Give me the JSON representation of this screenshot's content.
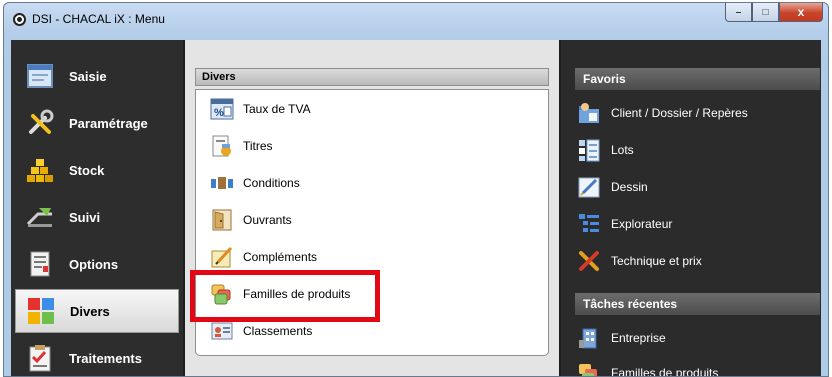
{
  "window": {
    "title": "DSI - CHACAL iX : Menu",
    "icon": "app-logo-icon",
    "controls": {
      "minimize": "–",
      "maximize": "□",
      "close": "x"
    }
  },
  "leftnav": {
    "items": [
      {
        "label": "Saisie",
        "icon": "form-window-icon"
      },
      {
        "label": "Paramétrage",
        "icon": "tools-icon"
      },
      {
        "label": "Stock",
        "icon": "gold-bars-icon"
      },
      {
        "label": "Suivi",
        "icon": "tracking-icon"
      },
      {
        "label": "Options",
        "icon": "document-options-icon"
      },
      {
        "label": "Divers",
        "icon": "colored-squares-icon",
        "selected": true
      },
      {
        "label": "Traitements",
        "icon": "clipboard-icon"
      }
    ]
  },
  "middle": {
    "header": "Divers",
    "items": [
      {
        "label": "Taux de TVA",
        "icon": "percent-icon"
      },
      {
        "label": "Titres",
        "icon": "title-document-icon"
      },
      {
        "label": "Conditions",
        "icon": "conditions-icon"
      },
      {
        "label": "Ouvrants",
        "icon": "door-icon"
      },
      {
        "label": "Compléments",
        "icon": "pencil-note-icon"
      },
      {
        "label": "Familles de produits",
        "icon": "product-families-icon",
        "highlighted": true
      },
      {
        "label": "Classements",
        "icon": "id-card-icon"
      }
    ]
  },
  "right": {
    "favorites_header": "Favoris",
    "favorites": [
      {
        "label": "Client / Dossier / Repères",
        "icon": "client-folder-icon"
      },
      {
        "label": "Lots",
        "icon": "lots-grid-icon"
      },
      {
        "label": "Dessin",
        "icon": "drawing-icon"
      },
      {
        "label": "Explorateur",
        "icon": "explorer-tree-icon"
      },
      {
        "label": "Technique et prix",
        "icon": "tools-price-icon"
      }
    ],
    "recent_header": "Tâches récentes",
    "recent": [
      {
        "label": "Entreprise",
        "icon": "building-icon"
      },
      {
        "label": "Familles de produits",
        "icon": "product-families-icon"
      }
    ]
  },
  "colors": {
    "highlight": "#e30613",
    "nav_bg": "#2d2d2d",
    "panel_bg": "#e4e4e4"
  }
}
